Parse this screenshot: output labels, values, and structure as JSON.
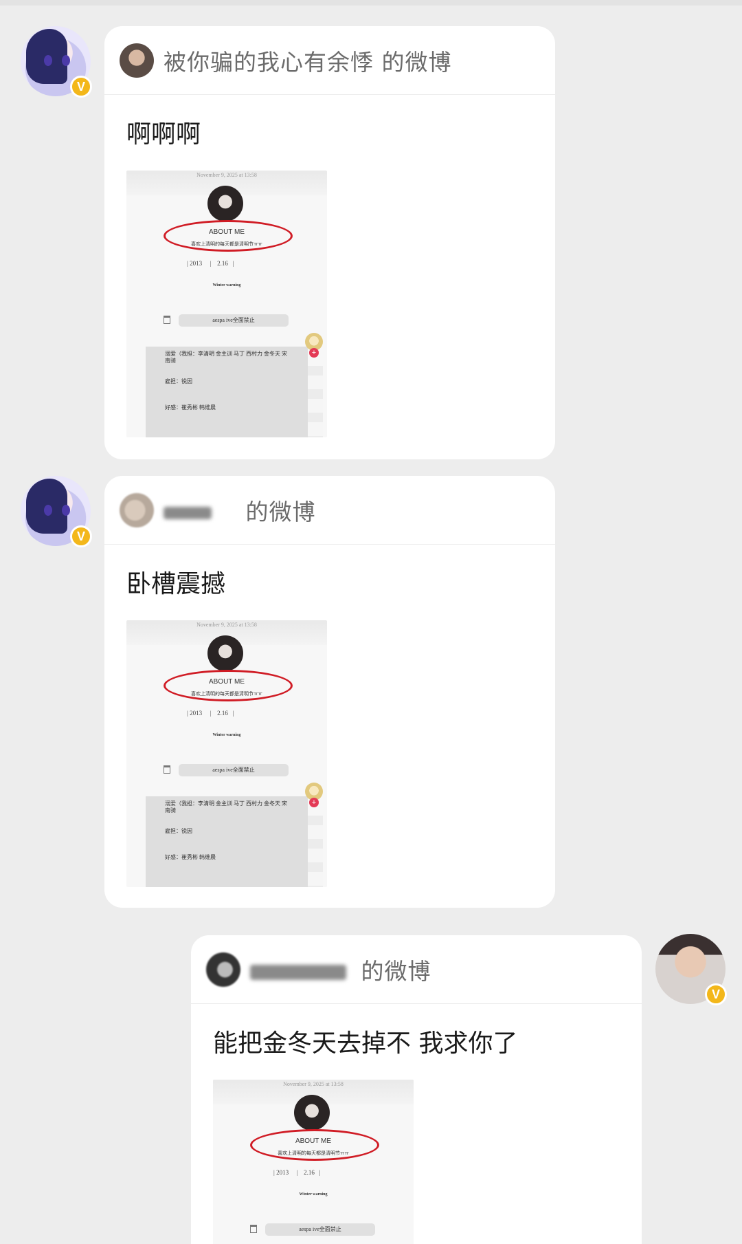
{
  "messages": [
    {
      "side": "left",
      "source_name": "被你骗的我心有余悸",
      "suffix": "的微博",
      "text": "啊啊啊"
    },
    {
      "side": "left",
      "source_name": "",
      "suffix": "的微博",
      "text": "卧槽震撼"
    },
    {
      "side": "right",
      "source_name": "",
      "suffix": "的微博",
      "text": "能把金冬天去掉不 我求你了"
    }
  ],
  "badge": {
    "label": "V",
    "color": "#f3b71a"
  },
  "screenshot": {
    "timestamp": "November 9, 2025 at 13:58",
    "about": "ABOUT ME",
    "subtitle": "喜欢上清明的每天都是清明节ㅠㅠ",
    "year": "2013",
    "date": "2.16",
    "warning": "Winter warning",
    "pill": "aespa ive全面禁止",
    "lines": [
      "溺爱（我担：李清明 金主训 马丁 西村力 金冬天 宋南骑",
      "雇担：锐因",
      "好感：崔秀彬 韩维晨"
    ],
    "plus": "+"
  },
  "colors": {
    "background": "#ededed",
    "card": "#ffffff",
    "highlight_oval": "#d01c25"
  }
}
